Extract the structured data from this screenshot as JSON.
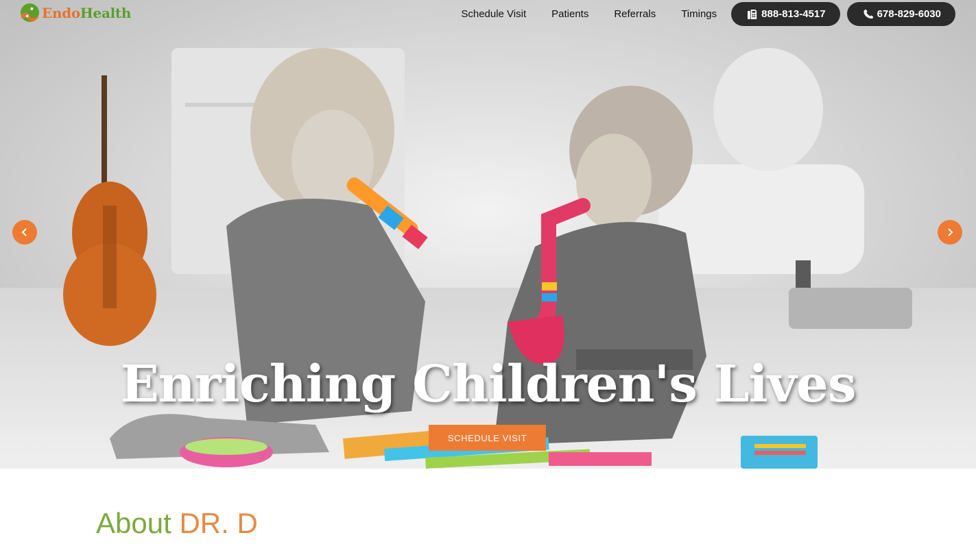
{
  "brand": {
    "name_part1": "Endo",
    "name_part2": "Health",
    "logo_icon": "leaf-globe-icon",
    "colors": {
      "orange": "#ee7b33",
      "green": "#5d9e2d",
      "dark": "#2b2b2b"
    }
  },
  "nav": {
    "links": [
      "Schedule Visit",
      "Patients",
      "Referrals",
      "Timings"
    ],
    "fax": {
      "icon": "fax-icon",
      "label": "888-813-4517"
    },
    "phone": {
      "icon": "phone-icon",
      "label": "678-829-6030"
    }
  },
  "hero": {
    "headline": "Enriching Children's Lives",
    "cta_label": "SCHEDULE VISIT",
    "prev_icon": "chevron-left-icon",
    "next_icon": "chevron-right-icon",
    "image_description_icon": "children-playing-instruments-photo"
  },
  "about": {
    "title_part1": "About ",
    "title_part2": "DR. D"
  }
}
